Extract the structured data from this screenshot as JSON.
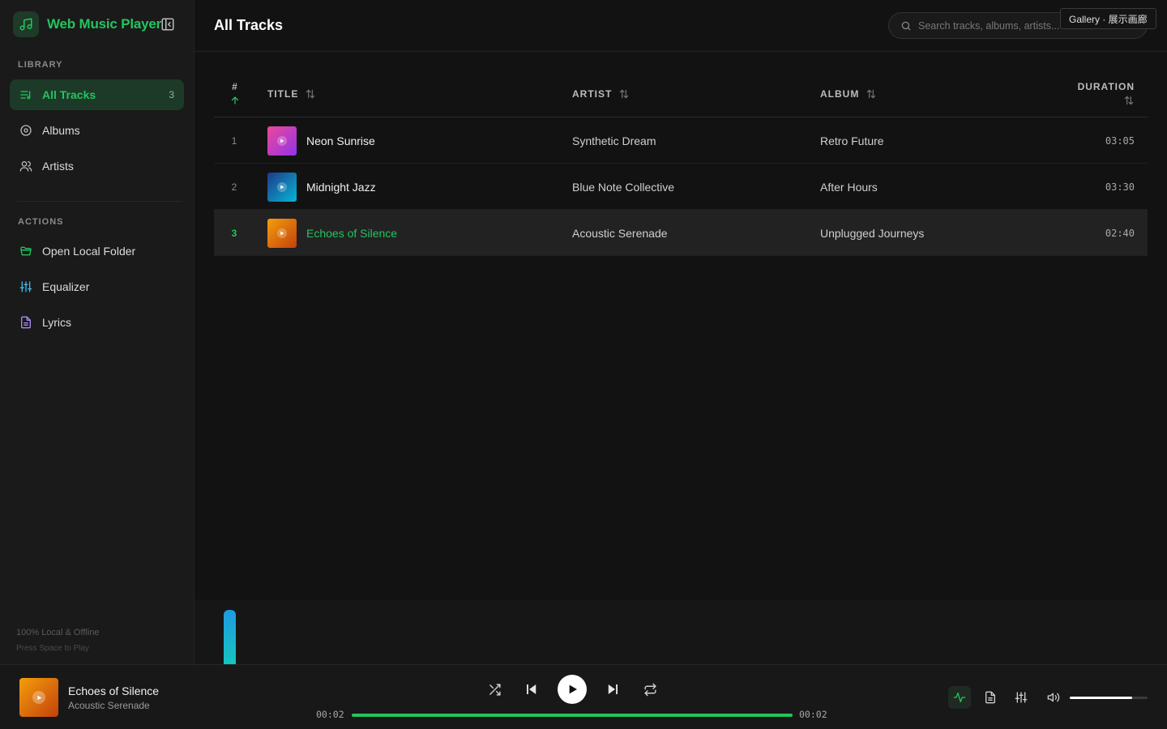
{
  "app": {
    "title": "Web Music Player"
  },
  "sidebar": {
    "library_label": "LIBRARY",
    "library_items": [
      {
        "label": "All Tracks",
        "icon": "list-music-icon",
        "count": "3",
        "active": true
      },
      {
        "label": "Albums",
        "icon": "disc-icon"
      },
      {
        "label": "Artists",
        "icon": "users-icon"
      }
    ],
    "actions_label": "ACTIONS",
    "action_items": [
      {
        "label": "Open Local Folder",
        "icon": "folder-open-icon",
        "color": "#22c55e"
      },
      {
        "label": "Equalizer",
        "icon": "sliders-icon",
        "color": "#3fb8e8"
      },
      {
        "label": "Lyrics",
        "icon": "file-text-icon",
        "color": "#a78bfa"
      }
    ],
    "footer_line1": "100% Local & Offline",
    "footer_line2": "Press Space to Play"
  },
  "header": {
    "title": "All Tracks",
    "search_placeholder": "Search tracks, albums, artists...",
    "tooltip": "Gallery · 展示画廊"
  },
  "table": {
    "columns": {
      "num": "#",
      "title": "TITLE",
      "artist": "ARTIST",
      "album": "ALBUM",
      "duration": "DURATION"
    },
    "rows": [
      {
        "num": "1",
        "title": "Neon Sunrise",
        "artist": "Synthetic Dream",
        "album": "Retro Future",
        "duration": "03:05"
      },
      {
        "num": "2",
        "title": "Midnight Jazz",
        "artist": "Blue Note Collective",
        "album": "After Hours",
        "duration": "03:30"
      },
      {
        "num": "3",
        "title": "Echoes of Silence",
        "artist": "Acoustic Serenade",
        "album": "Unplugged Journeys",
        "duration": "02:40",
        "playing": true
      }
    ]
  },
  "player": {
    "title": "Echoes of Silence",
    "artist": "Acoustic Serenade",
    "elapsed": "00:02",
    "total": "00:02",
    "progress_fraction": 1.0,
    "volume_fraction": 0.8
  },
  "colors": {
    "accent": "#22c55e",
    "background": "#121212",
    "sidebar": "#1a1a1a"
  }
}
